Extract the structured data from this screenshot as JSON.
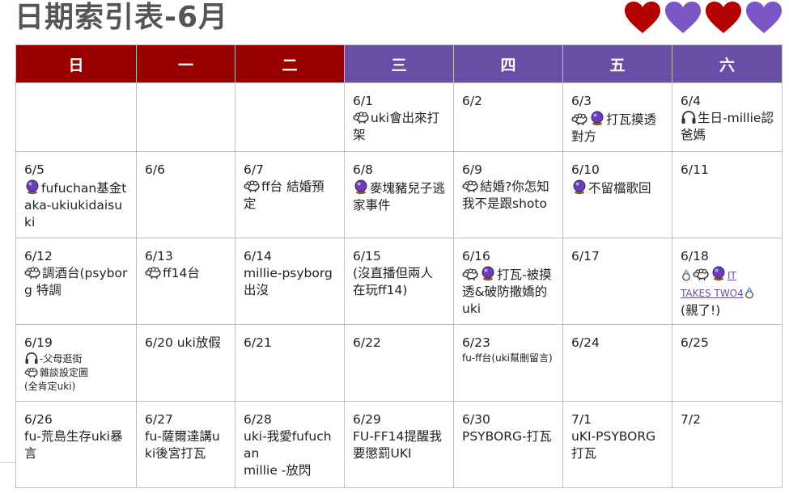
{
  "page": {
    "title": "日期索引表-6月"
  },
  "hearts": [
    {
      "color": "#b30000",
      "icon": "red-heart-icon"
    },
    {
      "color": "#7b57c6",
      "icon": "purple-heart-icon"
    },
    {
      "color": "#b30000",
      "icon": "red-heart-icon"
    },
    {
      "color": "#7b57c6",
      "icon": "purple-heart-icon"
    }
  ],
  "colors": {
    "weekend_header": "#990000",
    "weekday_header": "#6a4ea5",
    "icon_sheep": "sheep-icon",
    "icon_ball": "crystal-ball-icon",
    "icon_headphones": "headphones-icon",
    "icon_ring": "ring-icon"
  },
  "calendar": {
    "headers": [
      "日",
      "一",
      "二",
      "三",
      "四",
      "五",
      "六"
    ],
    "weeks": [
      {
        "days": [
          {
            "date": "",
            "lines": []
          },
          {
            "date": "",
            "lines": []
          },
          {
            "date": "",
            "lines": []
          },
          {
            "date": "6/1",
            "lines": [
              "uki會出來打架"
            ]
          },
          {
            "date": "6/2",
            "lines": []
          },
          {
            "date": "6/3",
            "lines": [
              "打瓦摸透對方"
            ]
          },
          {
            "date": "6/4",
            "lines": [
              "生日-millie認爸媽"
            ]
          }
        ]
      },
      {
        "days": [
          {
            "date": "6/5",
            "lines": [
              "fufuchan基金taka-ukiukidaisuki"
            ]
          },
          {
            "date": "6/6",
            "lines": []
          },
          {
            "date": "6/7",
            "lines": [
              "ff台 結婚預定"
            ]
          },
          {
            "date": "6/8",
            "lines": [
              "麥塊豬兒子逃家事件"
            ]
          },
          {
            "date": "6/9",
            "lines": [
              "結婚?你怎知我不是跟shoto"
            ]
          },
          {
            "date": "6/10",
            "lines": [
              "不留檔歌回"
            ]
          },
          {
            "date": "6/11",
            "lines": []
          }
        ]
      },
      {
        "days": [
          {
            "date": "6/12",
            "lines": [
              "調酒台(psyborg 特調"
            ]
          },
          {
            "date": "6/13",
            "lines": [
              "ff14台"
            ]
          },
          {
            "date": "6/14",
            "lines": [
              "millie-psyborg出沒"
            ]
          },
          {
            "date": "6/15",
            "lines": [
              "(沒直播但兩人在玩ff14)"
            ]
          },
          {
            "date": "6/16",
            "lines": [
              "打瓦-被摸透&破防撒嬌的uki"
            ]
          },
          {
            "date": "6/17",
            "lines": []
          },
          {
            "date": "6/18",
            "lines": [
              "IT",
              "TAKES TWO4",
              "(親了!)"
            ]
          }
        ]
      },
      {
        "days": [
          {
            "date": "6/19",
            "lines": [
              "-父母逛街",
              "雜談設定圖",
              "(全肯定uki)"
            ]
          },
          {
            "date": "6/20 uki放假",
            "lines": []
          },
          {
            "date": "6/21",
            "lines": []
          },
          {
            "date": "6/22",
            "lines": []
          },
          {
            "date": "6/23",
            "lines": [
              "fu-ff台(uki幫刪留言)"
            ]
          },
          {
            "date": "6/24",
            "lines": []
          },
          {
            "date": "6/25",
            "lines": []
          }
        ]
      },
      {
        "days": [
          {
            "date": "6/26",
            "lines": [
              "fu-荒島生存uki暴言"
            ]
          },
          {
            "date": "6/27",
            "lines": [
              "fu-薩爾達講uki後宮打瓦"
            ]
          },
          {
            "date": "6/28",
            "lines": [
              "uki-我愛fufuchan",
              "millie -放閃"
            ]
          },
          {
            "date": "6/29",
            "lines": [
              "FU-FF14提醒我要懲罰UKI"
            ]
          },
          {
            "date": "6/30",
            "lines": [
              "PSYBORG-打瓦"
            ]
          },
          {
            "date": "7/1",
            "lines": [
              "uKI-PSYBORG打瓦"
            ]
          },
          {
            "date": "7/2",
            "lines": []
          }
        ]
      }
    ]
  }
}
